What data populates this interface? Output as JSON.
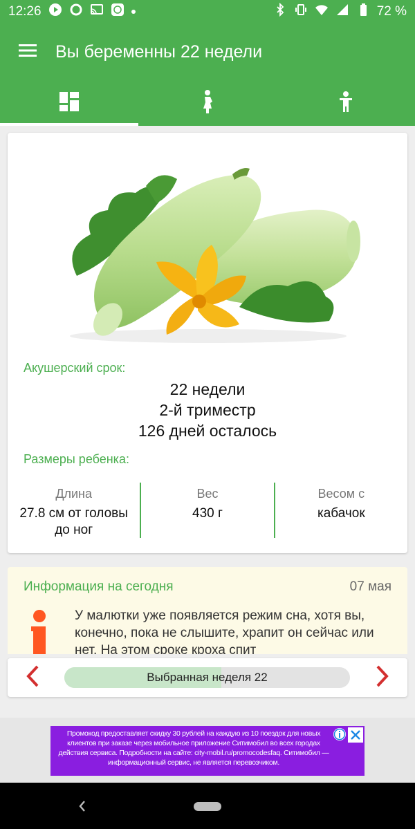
{
  "status_bar": {
    "time": "12:26",
    "battery": "72 %"
  },
  "app_bar": {
    "title": "Вы беременны 22 недели",
    "menu_icon": "hamburger-menu-icon"
  },
  "tabs": [
    {
      "icon": "dashboard-grid-icon",
      "active": true
    },
    {
      "icon": "pregnant-woman-icon",
      "active": false
    },
    {
      "icon": "child-icon",
      "active": false
    }
  ],
  "main_card": {
    "image": "zucchini-illustration",
    "term_label": "Акушерский срок:",
    "term_lines": [
      "22 недели",
      "2-й триместр",
      "126 дней осталось"
    ],
    "sizes_label": "Размеры ребенка:",
    "sizes": [
      {
        "label": "Длина",
        "value": "27.8 см от головы до ног"
      },
      {
        "label": "Вес",
        "value": "430 г"
      },
      {
        "label": "Весом с",
        "value": "кабачок"
      }
    ]
  },
  "info_card": {
    "title": "Информация на сегодня",
    "date": "07 мая",
    "icon": "info-i-icon",
    "text": "У малютки уже появляется режим сна, хотя вы, конечно, пока не слышите, храпит он сейчас или нет. На этом сроке кроха спит"
  },
  "week_selector": {
    "label": "Выбранная неделя 22",
    "progress": 0.55,
    "prev_icon": "chevron-left-icon",
    "next_icon": "chevron-right-icon"
  },
  "ad": {
    "text": "Промокод предоставляет скидку 30 рублей на каждую из 10 поездок для новых клиентов при заказе через мобильное приложение Ситимобил во всех городах действия сервиса. Подробности на сайте: city-mobil.ru/promocodesfaq. Ситимобил — информационный сервис, не является перевозчиком.",
    "background": "#8a1ee0"
  },
  "colors": {
    "accent": "#4caf50",
    "arrow": "#d32f2f",
    "info_icon": "#ff5722"
  }
}
